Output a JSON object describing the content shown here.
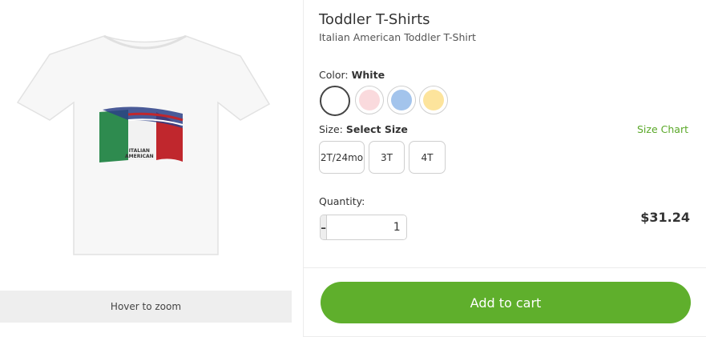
{
  "product": {
    "title": "Toddler T-Shirts",
    "subtitle": "Italian American Toddler T-Shirt",
    "image_print_text": [
      "ITALIAN",
      "AMERICAN"
    ]
  },
  "image": {
    "zoom_hint": "Hover to zoom"
  },
  "color": {
    "label": "Color:",
    "selected": "White",
    "swatches": [
      {
        "name": "White",
        "hex": "#ffffff",
        "selected": true
      },
      {
        "name": "Pink",
        "hex": "#fadadd",
        "selected": false
      },
      {
        "name": "Blue",
        "hex": "#a3c4ec",
        "selected": false
      },
      {
        "name": "Yellow",
        "hex": "#fde49c",
        "selected": false
      }
    ]
  },
  "size": {
    "label": "Size:",
    "selected": "Select Size",
    "chart_link": "Size Chart",
    "options": [
      "2T/24mo",
      "3T",
      "4T"
    ]
  },
  "quantity": {
    "label": "Quantity:",
    "value": "1",
    "minus": "-",
    "plus": "+"
  },
  "price": "$31.24",
  "cart": {
    "button_label": "Add to cart"
  },
  "colors": {
    "accent_green": "#5faf2c",
    "link_green": "#5aa828"
  }
}
